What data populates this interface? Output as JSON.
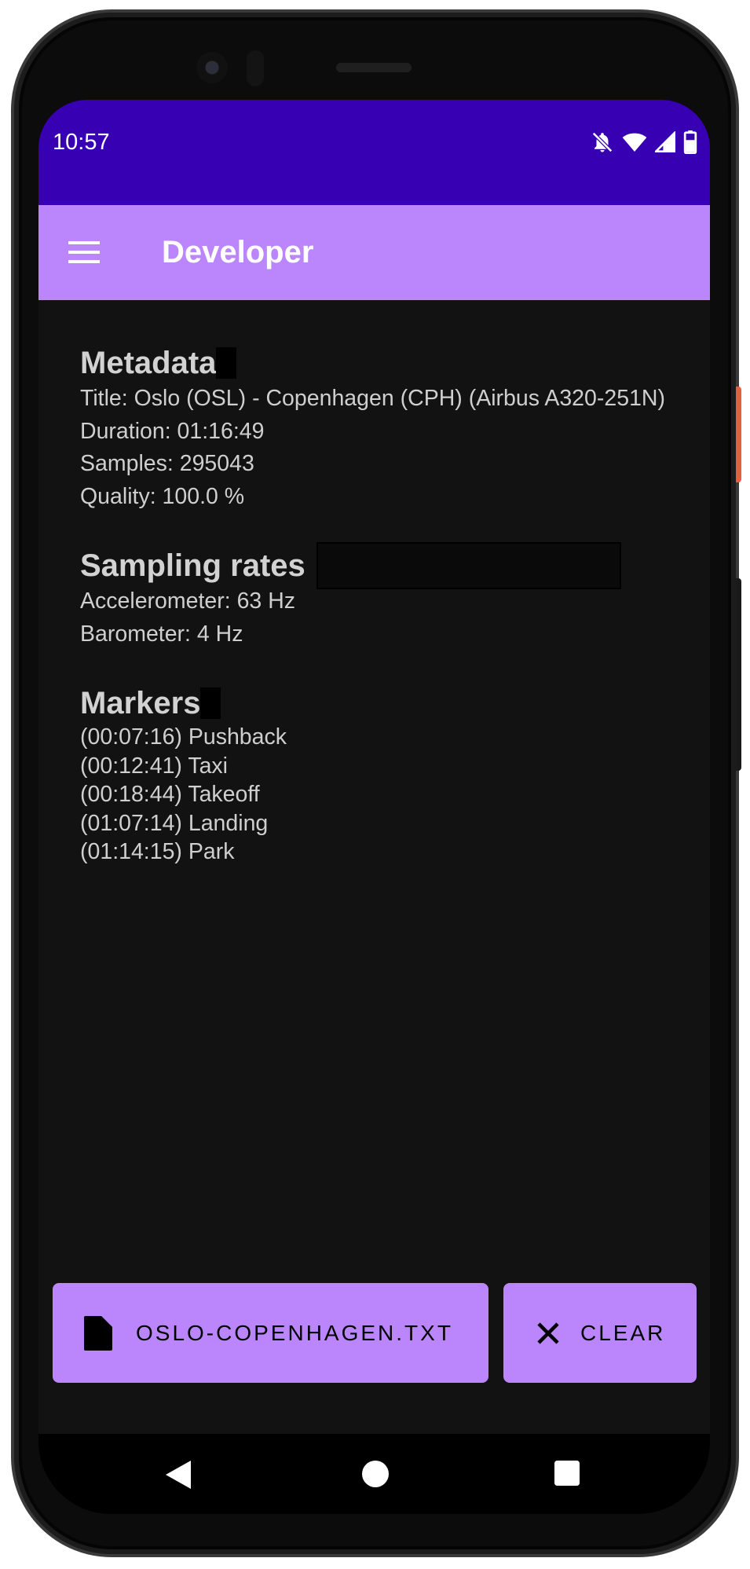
{
  "status_bar": {
    "time": "10:57",
    "icons": [
      "notifications-off-icon",
      "wifi-icon",
      "cell-signal-icon",
      "battery-icon"
    ]
  },
  "app_bar": {
    "menu_icon": "hamburger-menu-icon",
    "title": "Developer"
  },
  "metadata": {
    "heading": "Metadata",
    "lines": [
      "Title: Oslo (OSL) - Copenhagen (CPH) (Airbus A320-251N)",
      "Duration: 01:16:49",
      "Samples: 295043",
      "Quality: 100.0 %"
    ]
  },
  "sampling_rates": {
    "heading": "Sampling rates",
    "lines": [
      "Accelerometer: 63 Hz",
      "Barometer: 4 Hz"
    ]
  },
  "markers": {
    "heading": "Markers",
    "items": [
      "(00:07:16) Pushback",
      "(00:12:41) Taxi",
      "(00:18:44) Takeoff",
      "(01:07:14) Landing",
      "(01:14:15) Park"
    ]
  },
  "actions": {
    "file_button": {
      "label": "OSLO-COPENHAGEN.TXT",
      "icon": "file-icon"
    },
    "clear_button": {
      "label": "CLEAR",
      "icon": "close-icon"
    }
  },
  "nav_bar": {
    "icons": [
      "back-icon",
      "home-icon",
      "recents-icon"
    ]
  },
  "colors": {
    "status_bar": "#3700b3",
    "app_bar": "#bb86fc",
    "background": "#121212",
    "button": "#bb86fc",
    "text": "#cfcfcf"
  }
}
